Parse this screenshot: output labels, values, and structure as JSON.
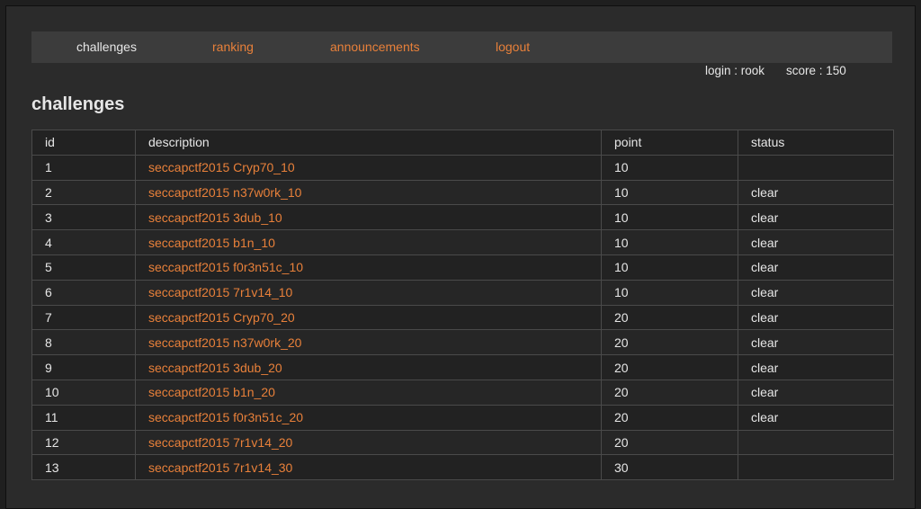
{
  "nav": {
    "items": [
      {
        "label": "challenges",
        "active": true
      },
      {
        "label": "ranking",
        "active": false
      },
      {
        "label": "announcements",
        "active": false
      },
      {
        "label": "logout",
        "active": false
      }
    ]
  },
  "user": {
    "login": "login : rook",
    "score": "score : 150"
  },
  "page": {
    "title": "challenges"
  },
  "table": {
    "columns": [
      "id",
      "description",
      "point",
      "status"
    ],
    "rows": [
      {
        "id": "1",
        "description": "seccapctf2015 Cryp70_10",
        "point": "10",
        "status": ""
      },
      {
        "id": "2",
        "description": "seccapctf2015 n37w0rk_10",
        "point": "10",
        "status": "clear"
      },
      {
        "id": "3",
        "description": "seccapctf2015 3dub_10",
        "point": "10",
        "status": "clear"
      },
      {
        "id": "4",
        "description": "seccapctf2015 b1n_10",
        "point": "10",
        "status": "clear"
      },
      {
        "id": "5",
        "description": "seccapctf2015 f0r3n51c_10",
        "point": "10",
        "status": "clear"
      },
      {
        "id": "6",
        "description": "seccapctf2015 7r1v14_10",
        "point": "10",
        "status": "clear"
      },
      {
        "id": "7",
        "description": "seccapctf2015 Cryp70_20",
        "point": "20",
        "status": "clear"
      },
      {
        "id": "8",
        "description": "seccapctf2015 n37w0rk_20",
        "point": "20",
        "status": "clear"
      },
      {
        "id": "9",
        "description": "seccapctf2015 3dub_20",
        "point": "20",
        "status": "clear"
      },
      {
        "id": "10",
        "description": "seccapctf2015 b1n_20",
        "point": "20",
        "status": "clear"
      },
      {
        "id": "11",
        "description": "seccapctf2015 f0r3n51c_20",
        "point": "20",
        "status": "clear"
      },
      {
        "id": "12",
        "description": "seccapctf2015 7r1v14_20",
        "point": "20",
        "status": ""
      },
      {
        "id": "13",
        "description": "seccapctf2015 7r1v14_30",
        "point": "30",
        "status": ""
      }
    ]
  },
  "colors": {
    "link": "#e8803a",
    "text": "#e6e6e6",
    "background": "#2b2b2b",
    "navbar": "#3c3c3c"
  }
}
